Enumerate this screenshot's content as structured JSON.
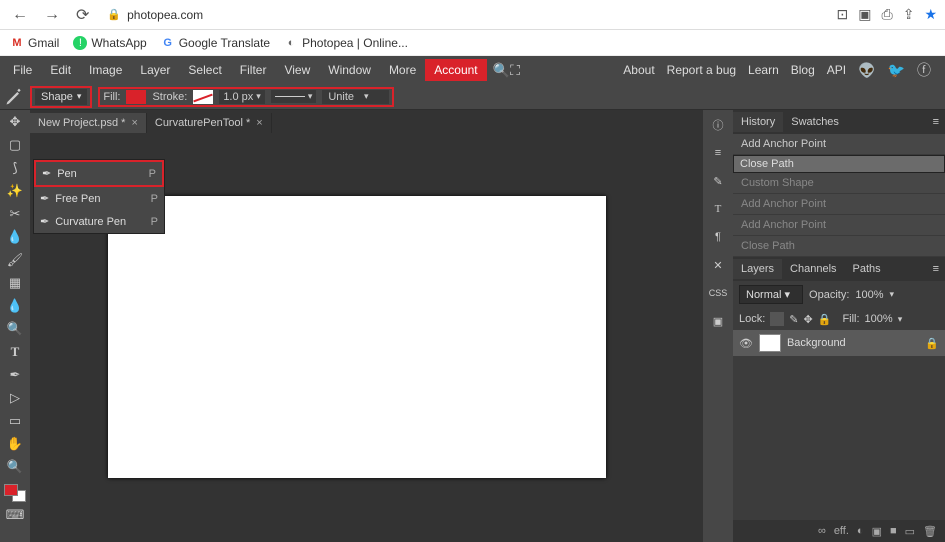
{
  "browser": {
    "url": "photopea.com",
    "star": "★"
  },
  "bookmarks": [
    {
      "label": "Gmail",
      "color": "#d93025",
      "glyph": "M"
    },
    {
      "label": "WhatsApp",
      "color": "#25d366",
      "glyph": "●"
    },
    {
      "label": "Google Translate",
      "color": "#4285f4",
      "glyph": "G"
    },
    {
      "label": "Photopea | Online...",
      "color": "#666",
      "glyph": "◐"
    }
  ],
  "menu": [
    "File",
    "Edit",
    "Image",
    "Layer",
    "Select",
    "Filter",
    "View",
    "Window",
    "More",
    "Account"
  ],
  "menu_right": [
    "About",
    "Report a bug",
    "Learn",
    "Blog",
    "API"
  ],
  "optbar": {
    "shape_label": "Shape",
    "fill_label": "Fill:",
    "stroke_label": "Stroke:",
    "width": "1.0 px",
    "mode": "Unite"
  },
  "tabs": [
    {
      "label": "New Project.psd *",
      "active": false
    },
    {
      "label": "CurvaturePenTool *",
      "active": true
    }
  ],
  "pen_menu": [
    {
      "label": "Pen",
      "shortcut": "P",
      "hl": true
    },
    {
      "label": "Free Pen",
      "shortcut": "P",
      "hl": false
    },
    {
      "label": "Curvature Pen",
      "shortcut": "P",
      "hl": false
    }
  ],
  "right_tools": [
    "ⓘ",
    "≡",
    "✎",
    "T",
    "¶",
    "✕",
    "CSS",
    "▣"
  ],
  "panel1_tabs": [
    "History",
    "Swatches"
  ],
  "history": [
    {
      "t": "Add Anchor Point",
      "sel": false,
      "dim": false
    },
    {
      "t": "Close Path",
      "sel": true,
      "dim": false
    },
    {
      "t": "Custom Shape",
      "sel": false,
      "dim": true
    },
    {
      "t": "Add Anchor Point",
      "sel": false,
      "dim": true
    },
    {
      "t": "Add Anchor Point",
      "sel": false,
      "dim": true
    },
    {
      "t": "Close Path",
      "sel": false,
      "dim": true
    }
  ],
  "panel2_tabs": [
    "Layers",
    "Channels",
    "Paths"
  ],
  "layers": {
    "blend": "Normal",
    "opacity_label": "Opacity:",
    "opacity": "100%",
    "lock_label": "Lock:",
    "fill_label": "Fill:",
    "fill": "100%",
    "items": [
      {
        "name": "Background"
      }
    ]
  },
  "foot": [
    "∞",
    "eff.",
    "◐",
    "▣",
    "■",
    "▭",
    "🗑"
  ]
}
